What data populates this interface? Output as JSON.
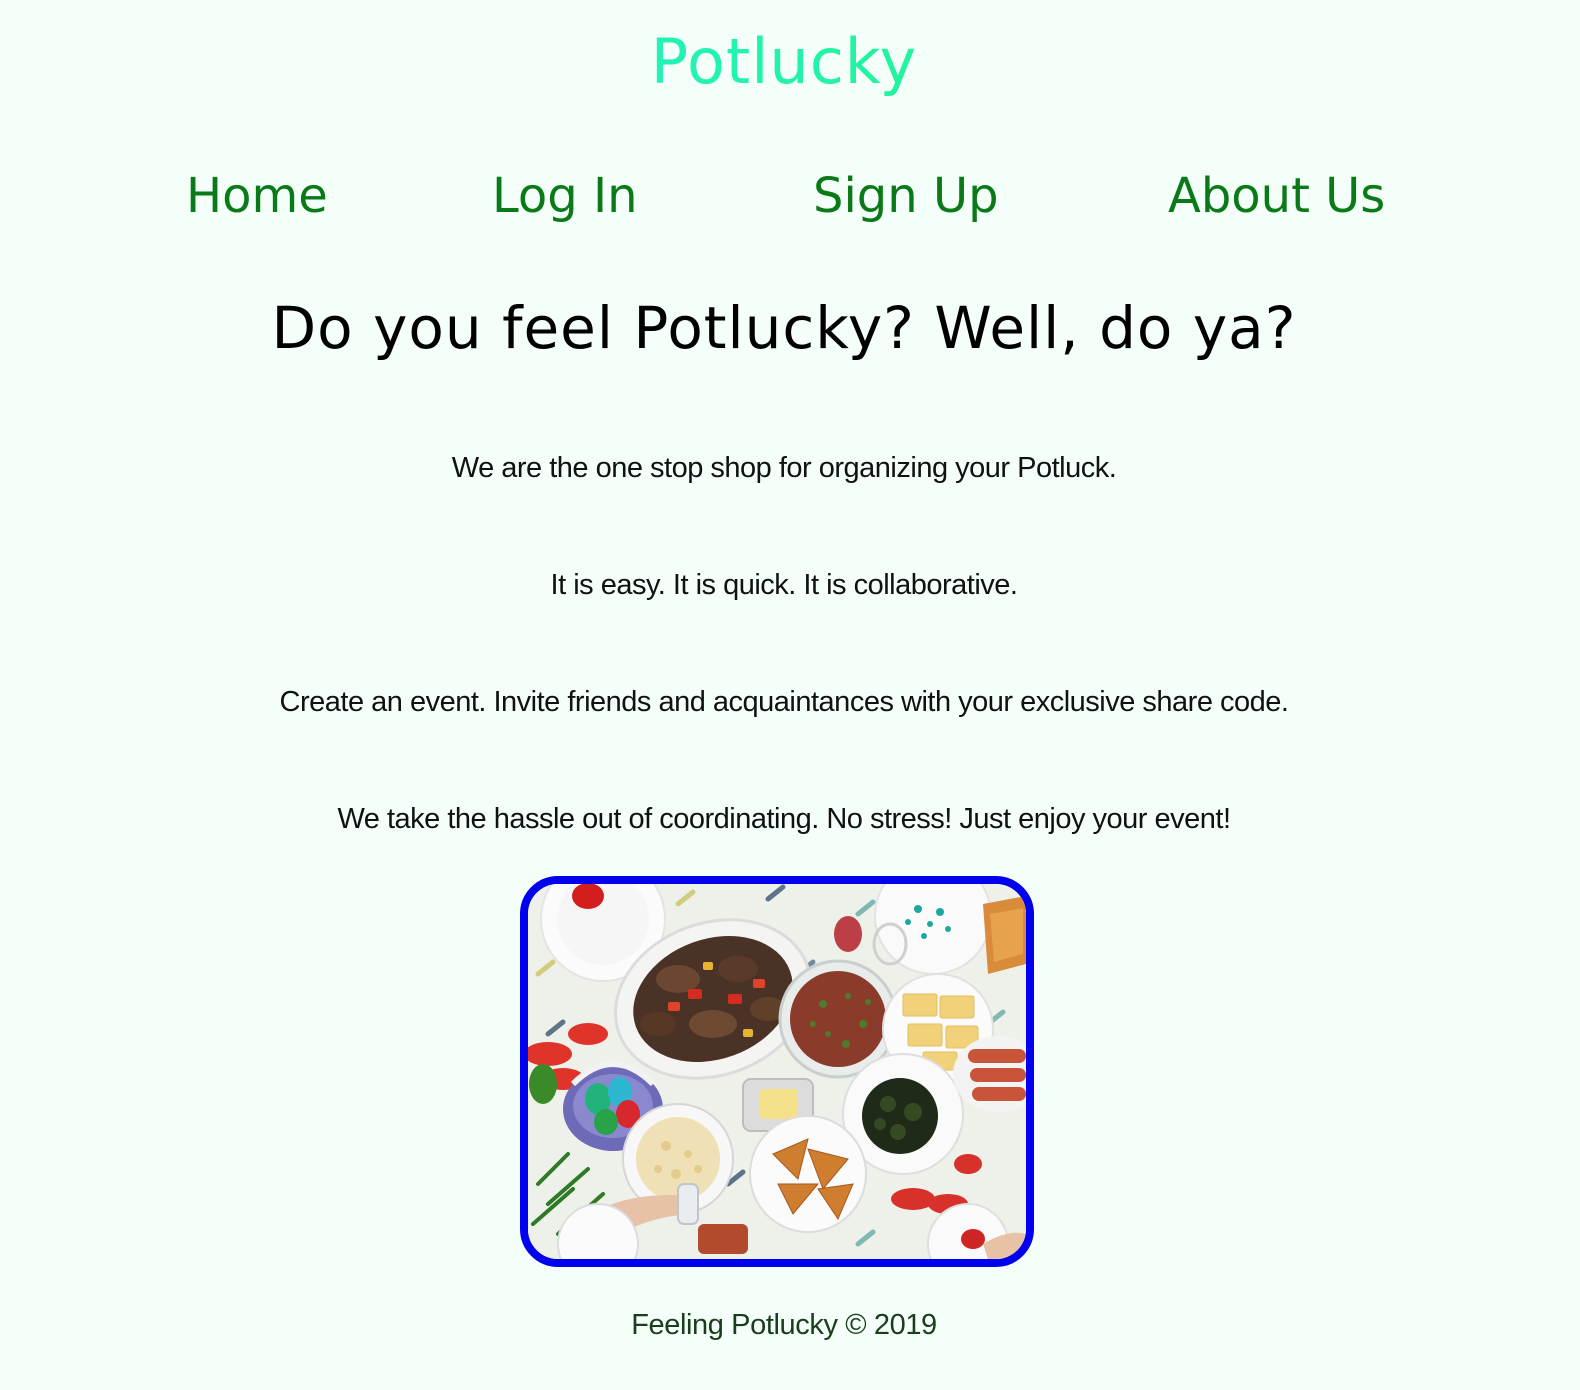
{
  "brand": {
    "title": "Potlucky"
  },
  "nav": {
    "home": "Home",
    "login": "Log In",
    "signup": "Sign Up",
    "about": "About Us"
  },
  "hero": {
    "headline": "Do you feel Potlucky? Well, do ya?",
    "paragraphs": [
      "We are the one stop shop for organizing your Potluck.",
      "It is easy. It is quick. It is collaborative.",
      "Create an event. Invite friends and acquaintances with your exclusive share code.",
      "We take the hassle out of coordinating. No stress! Just enjoy your event!"
    ]
  },
  "footer": {
    "text": "Feeling Potlucky © 2019"
  },
  "colors": {
    "background": "#f3fff8",
    "nav_link": "#0a7a18",
    "brand_gradient_start": "#22f3f6",
    "brand_gradient_end": "#33ee44",
    "photo_border": "#0000ee"
  }
}
